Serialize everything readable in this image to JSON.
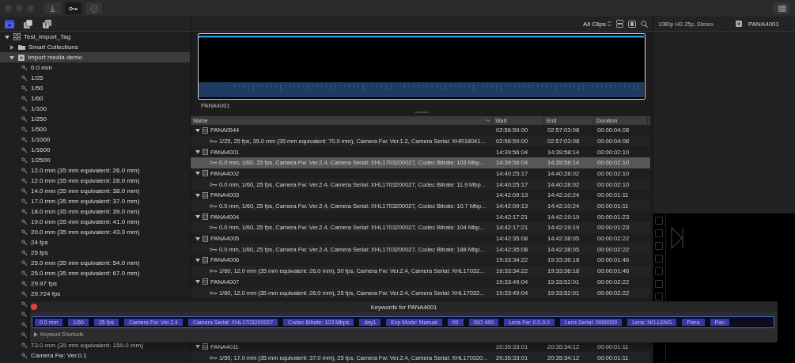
{
  "viewer_header": {
    "format": "1080p HD 25p, Stereo",
    "clip": "PANA4001"
  },
  "browser_toolbar": {
    "filter": "All Clips"
  },
  "sidebar": {
    "items": [
      {
        "kind": "library",
        "label": "Test_Import_Tag",
        "expanded": true,
        "selected": false,
        "children": [
          {
            "kind": "folder",
            "label": "Smart Collections",
            "expanded": false,
            "selected": false
          },
          {
            "kind": "event",
            "label": "Import media demo",
            "expanded": true,
            "selected": true,
            "children": [
              {
                "kind": "keyword",
                "label": "0.0 mm",
                "selected": false
              },
              {
                "kind": "keyword",
                "label": "1/25",
                "selected": false
              },
              {
                "kind": "keyword",
                "label": "1/50",
                "selected": false
              },
              {
                "kind": "keyword",
                "label": "1/60",
                "selected": false
              },
              {
                "kind": "keyword",
                "label": "1/100",
                "selected": false
              },
              {
                "kind": "keyword",
                "label": "1/250",
                "selected": false
              },
              {
                "kind": "keyword",
                "label": "1/500",
                "selected": false
              },
              {
                "kind": "keyword",
                "label": "1/1000",
                "selected": false
              },
              {
                "kind": "keyword",
                "label": "1/1600",
                "selected": false
              },
              {
                "kind": "keyword",
                "label": "1/2500",
                "selected": false
              },
              {
                "kind": "keyword",
                "label": "12.0 mm (35 mm equivalent: 26.0 mm)",
                "selected": false
              },
              {
                "kind": "keyword",
                "label": "12.0 mm (35 mm equivalent: 28.0 mm)",
                "selected": false
              },
              {
                "kind": "keyword",
                "label": "14.0 mm (35 mm equivalent: 38.0 mm)",
                "selected": false
              },
              {
                "kind": "keyword",
                "label": "17.0 mm (35 mm equivalent: 37.0 mm)",
                "selected": false
              },
              {
                "kind": "keyword",
                "label": "18.0 mm (35 mm equivalent: 39.0 mm)",
                "selected": false
              },
              {
                "kind": "keyword",
                "label": "19.0 mm (35 mm equivalent: 41.0 mm)",
                "selected": false
              },
              {
                "kind": "keyword",
                "label": "20.0 mm (35 mm equivalent: 43.0 mm)",
                "selected": false
              },
              {
                "kind": "keyword",
                "label": "24 fps",
                "selected": false
              },
              {
                "kind": "keyword",
                "label": "25 fps",
                "selected": false
              },
              {
                "kind": "keyword",
                "label": "25.0 mm (35 mm equivalent: 54.0 mm)",
                "selected": false
              },
              {
                "kind": "keyword",
                "label": "25.0 mm (35 mm equivalent: 67.0 mm)",
                "selected": false
              },
              {
                "kind": "keyword",
                "label": "29.97 fps",
                "selected": false
              },
              {
                "kind": "keyword",
                "label": "29.724 fps",
                "selected": false
              },
              {
                "kind": "covered"
              },
              {
                "kind": "covered"
              },
              {
                "kind": "covered"
              },
              {
                "kind": "covered"
              },
              {
                "kind": "keyword",
                "label": "73.0 mm (35 mm equivalent: 159.0 mm)",
                "selected": false
              },
              {
                "kind": "keyword",
                "label": "Camera Fw: Ver.0.1",
                "selected": false
              }
            ]
          }
        ]
      }
    ]
  },
  "filmstrip": {
    "clip_label": "PANA4001"
  },
  "table": {
    "columns": [
      {
        "label": "Name",
        "sorted": true
      },
      {
        "label": "Start",
        "sorted": false
      },
      {
        "label": "End",
        "sorted": false
      },
      {
        "label": "Duration",
        "sorted": false
      }
    ],
    "rows": [
      {
        "kind": "clip",
        "name": "PANA0544",
        "start": "02:56:59:00",
        "end": "02:57:03:08",
        "duration": "00:00:04:08",
        "expanded": true,
        "selected": false,
        "children": [
          {
            "kind": "keywords",
            "name": "1/25, 25 fps, 35.0 mm (35 mm equivalent: 70.0 mm), Camera Fw: Ver.1.2, Camera Serial: XHR18041...",
            "start": "02:56:59:00",
            "end": "02:57:03:08",
            "duration": "00:00:04:08",
            "selected": false
          }
        ]
      },
      {
        "kind": "clip",
        "name": "PANA4001",
        "start": "14:39:56:04",
        "end": "14:39:58:14",
        "duration": "00:00:02:10",
        "expanded": true,
        "selected": false,
        "children": [
          {
            "kind": "keywords",
            "name": "0.0 mm, 1/60, 25 fps, Camera Fw: Ver.2.4, Camera Serial: XHL1703200027, Codec Bitrate: 103 Mbp...",
            "start": "14:39:56:04",
            "end": "14:39:58:14",
            "duration": "00:00:02:10",
            "selected": true
          }
        ]
      },
      {
        "kind": "clip",
        "name": "PANA4002",
        "start": "14:40:25:17",
        "end": "14:40:28:02",
        "duration": "00:00:02:10",
        "expanded": true,
        "selected": false,
        "children": [
          {
            "kind": "keywords",
            "name": "0.0 mm, 1/60, 25 fps, Camera Fw: Ver.2.4, Camera Serial: XHL1703200027, Codec Bitrate: 11.9 Mbp...",
            "start": "14:40:25:17",
            "end": "14:40:28:02",
            "duration": "00:00:02:10",
            "selected": false
          }
        ]
      },
      {
        "kind": "clip",
        "name": "PANA4003",
        "start": "14:42:09:13",
        "end": "14:42:10:24",
        "duration": "00:00:01:11",
        "expanded": true,
        "selected": false,
        "children": [
          {
            "kind": "keywords",
            "name": "0.0 mm, 1/60, 25 fps, Camera Fw: Ver.2.4, Camera Serial: XHL1703200027, Codec Bitrate: 10.7 Mbp...",
            "start": "14:42:09:13",
            "end": "14:42:10:24",
            "duration": "00:00:01:11",
            "selected": false
          }
        ]
      },
      {
        "kind": "clip",
        "name": "PANA4004",
        "start": "14:42:17:21",
        "end": "14:42:19:19",
        "duration": "00:00:01:23",
        "expanded": true,
        "selected": false,
        "children": [
          {
            "kind": "keywords",
            "name": "0.0 mm, 1/60, 25 fps, Camera Fw: Ver.2.4, Camera Serial: XHL1703200027, Codec Bitrate: 104 Mbp...",
            "start": "14:42:17:21",
            "end": "14:42:19:19",
            "duration": "00:00:01:23",
            "selected": false
          }
        ]
      },
      {
        "kind": "clip",
        "name": "PANA4005",
        "start": "14:42:35:08",
        "end": "14:42:38:05",
        "duration": "00:00:02:22",
        "expanded": true,
        "selected": false,
        "children": [
          {
            "kind": "keywords",
            "name": "0.0 mm, 1/60, 25 fps, Camera Fw: Ver.2.4, Camera Serial: XHL1703200027, Codec Bitrate: 188 Mbp...",
            "start": "14:42:35:08",
            "end": "14:42:38:05",
            "duration": "00:00:02:22",
            "selected": false
          }
        ]
      },
      {
        "kind": "clip",
        "name": "PANA4006",
        "start": "19:33:34:22",
        "end": "19:33:36:18",
        "duration": "00:00:01:46",
        "expanded": true,
        "selected": false,
        "children": [
          {
            "kind": "keywords",
            "name": "1/60, 12.0 mm (35 mm equivalent: 26.0 mm), 50 fps, Camera Fw: Ver.2.4, Camera Serial: XHL17032...",
            "start": "19:33:34:22",
            "end": "19:33:36:18",
            "duration": "00:00:01:46",
            "selected": false
          }
        ]
      },
      {
        "kind": "clip",
        "name": "PANA4007",
        "start": "19:33:49:04",
        "end": "19:33:52:01",
        "duration": "00:00:02:22",
        "expanded": true,
        "selected": false,
        "children": [
          {
            "kind": "keywords",
            "name": "1/60, 12.0 mm (35 mm equivalent: 26.0 mm), 25 fps, Camera Fw: Ver.2.4, Camera Serial: XHL17032...",
            "start": "19:33:49:04",
            "end": "19:33:52:01",
            "duration": "00:00:02:22",
            "selected": false
          }
        ]
      },
      {
        "kind": "covered"
      },
      {
        "kind": "covered"
      },
      {
        "kind": "covered"
      },
      {
        "kind": "covered"
      },
      {
        "kind": "clip",
        "name": "PANA4011",
        "start": "20:35:33:01",
        "end": "20:35:34:12",
        "duration": "00:00:01:11",
        "expanded": true,
        "selected": false,
        "children": [
          {
            "kind": "keywords",
            "name": "1/50, 17.0 mm (35 mm equivalent: 37.0 mm), 25 fps, Camera Fw: Ver.2.4, Camera Serial: XHL170320...",
            "start": "20:35:33:01",
            "end": "20:35:34:12",
            "duration": "00:00:01:11",
            "selected": false
          }
        ]
      }
    ]
  },
  "keywords_popup": {
    "title": "Keywords for PANA4001",
    "tokens": [
      "0.0 mm",
      "1/60",
      "25 fps",
      "Camera Fw: Ver.2.4",
      "Camera Serial: XHL1703200027",
      "Codec Bitrate: 103 Mbps",
      "day1",
      "Exp Mode: Manual",
      "f/0",
      "ISO 400",
      "Lens Fw: 0.0.0.0",
      "Lens Serial: 0000000",
      "Lens: NO-LENS",
      "Pana",
      "Pan"
    ],
    "shortcuts": {
      "label": "Keyword Shortcuts",
      "expanded": false
    }
  }
}
